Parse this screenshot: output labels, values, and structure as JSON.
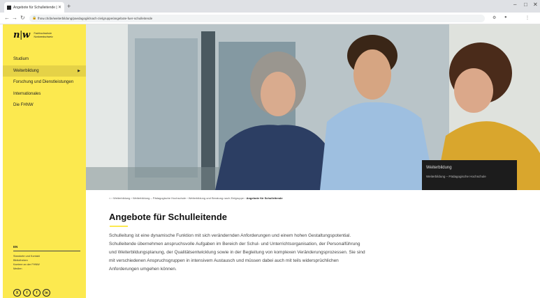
{
  "browser": {
    "tab_title": "Angebote für Schulleitende | FHNW",
    "url": "fhnw.ch/de/weiterbildung/paedagogik/nach-zielgruppe/angebote-fuer-schulleitende"
  },
  "sidebar": {
    "logo_mark": "n",
    "logo_mark_sep": "|",
    "logo_mark2": "w",
    "logo_name_line1": "Fachhochschule",
    "logo_name_line2": "Nordwestschweiz",
    "items": [
      {
        "label": "Studium"
      },
      {
        "label": "Weiterbildung"
      },
      {
        "label": "Forschung und Dienstleistungen"
      },
      {
        "label": "Internationales"
      },
      {
        "label": "Die FHNW"
      }
    ],
    "language": "EN",
    "links": [
      "Standorte und Kontakt",
      "Bibliotheken",
      "Karriere an der FHNW",
      "Medien"
    ],
    "social": [
      "X",
      "f",
      "f",
      "in"
    ]
  },
  "hero": {
    "card_title": "Weiterbildung",
    "card_sub": "Weiterbildung – Pädagogische Hochschule"
  },
  "breadcrumb": {
    "home": "⌂",
    "items": [
      "Weiterbildung",
      "Weiterbildung – Pädagogische Hochschule",
      "Weiterbildung und Beratung nach Zielgruppe"
    ],
    "current": "Angebote für Schulleitende"
  },
  "content": {
    "title": "Angebote für Schulleitende",
    "intro": "Schulleitung ist eine dynamische Funktion mit sich verändernden Anforderungen und einem hohen Gestaltungspotential. Schulleitende übernehmen anspruchsvolle Aufgaben im Bereich der Schul- und Unterrichtsorganisation, der Personalführung und Weiterbildungsplanung, der Qualitätsentwicklung sowie in der Begleitung von komplexen Veränderungsprozessen. Sie sind mit verschiedenen Anspruchsgruppen in intensivem Austausch und müssen dabei auch mit teils widersprüchlichen Anforderungen umgehen können."
  },
  "colors": {
    "brand_yellow": "#fce94f",
    "card_bg": "#1c1c1c"
  }
}
